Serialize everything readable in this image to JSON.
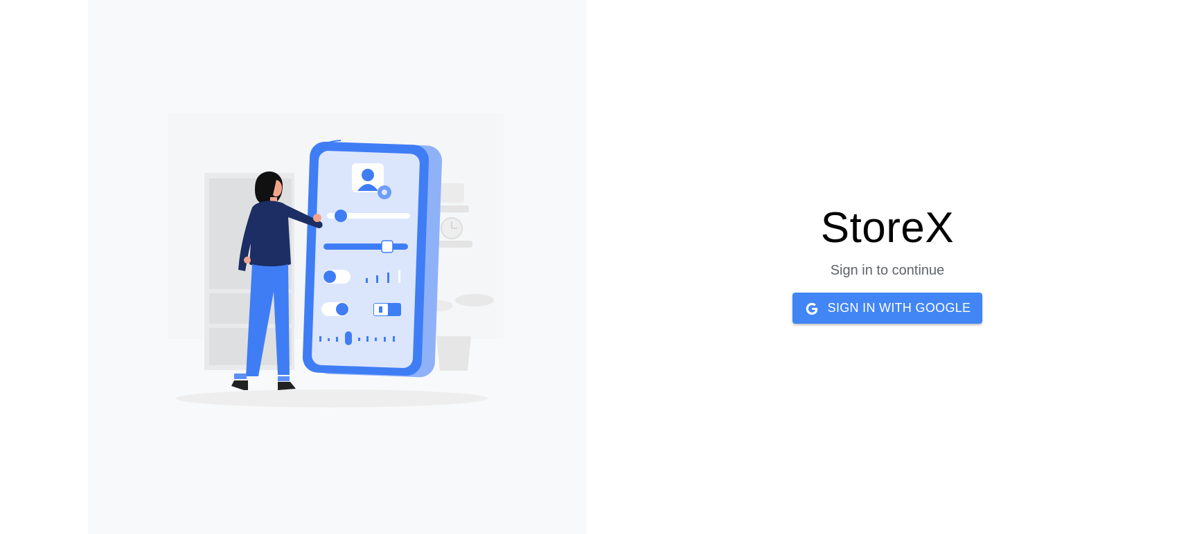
{
  "app": {
    "title": "StoreX"
  },
  "auth": {
    "subtitle": "Sign in to continue",
    "google_button_label": "SIGN IN WITH GOOGLE",
    "google_icon": "google-g-icon"
  },
  "illustration": {
    "name": "person-configuring-phone-settings-illustration"
  },
  "colors": {
    "accent": "#4285f4",
    "panel_background": "#f8f9fa",
    "title_text": "#000000",
    "subtitle_text": "#5f6368",
    "button_text": "#ffffff",
    "illustration_primary": "#3f7df5",
    "illustration_dark": "#1c2e63"
  }
}
